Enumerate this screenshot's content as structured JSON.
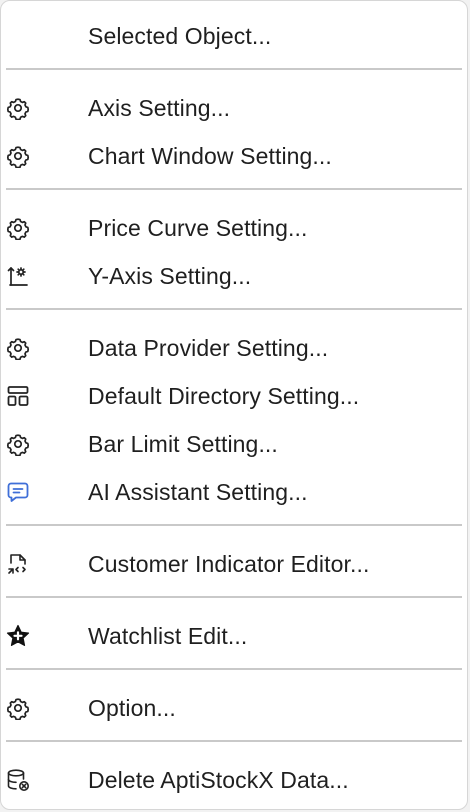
{
  "menu": {
    "accent_color": "#3f6fd8",
    "items": [
      {
        "id": "selected-object",
        "label": "Selected Object...",
        "icon": "none"
      },
      {
        "id": "axis-setting",
        "label": "Axis Setting...",
        "icon": "gear-icon"
      },
      {
        "id": "chart-window-setting",
        "label": "Chart Window Setting...",
        "icon": "gear-icon"
      },
      {
        "id": "price-curve-setting",
        "label": "Price Curve Setting...",
        "icon": "gear-icon"
      },
      {
        "id": "y-axis-setting",
        "label": "Y-Axis Setting...",
        "icon": "y-axis-gear-icon"
      },
      {
        "id": "data-provider-setting",
        "label": "Data Provider Setting...",
        "icon": "gear-icon"
      },
      {
        "id": "default-directory-setting",
        "label": "Default Directory Setting...",
        "icon": "layout-icon"
      },
      {
        "id": "bar-limit-setting",
        "label": "Bar Limit Setting...",
        "icon": "gear-icon"
      },
      {
        "id": "ai-assistant-setting",
        "label": "AI Assistant Setting...",
        "icon": "chat-icon"
      },
      {
        "id": "customer-indicator-editor",
        "label": "Customer Indicator Editor...",
        "icon": "code-file-icon"
      },
      {
        "id": "watchlist-edit",
        "label": "Watchlist Edit...",
        "icon": "star-plus-icon"
      },
      {
        "id": "option",
        "label": "Option...",
        "icon": "gear-icon"
      },
      {
        "id": "delete-data",
        "label": "Delete AptiStockX Data...",
        "icon": "database-delete-icon"
      }
    ]
  }
}
